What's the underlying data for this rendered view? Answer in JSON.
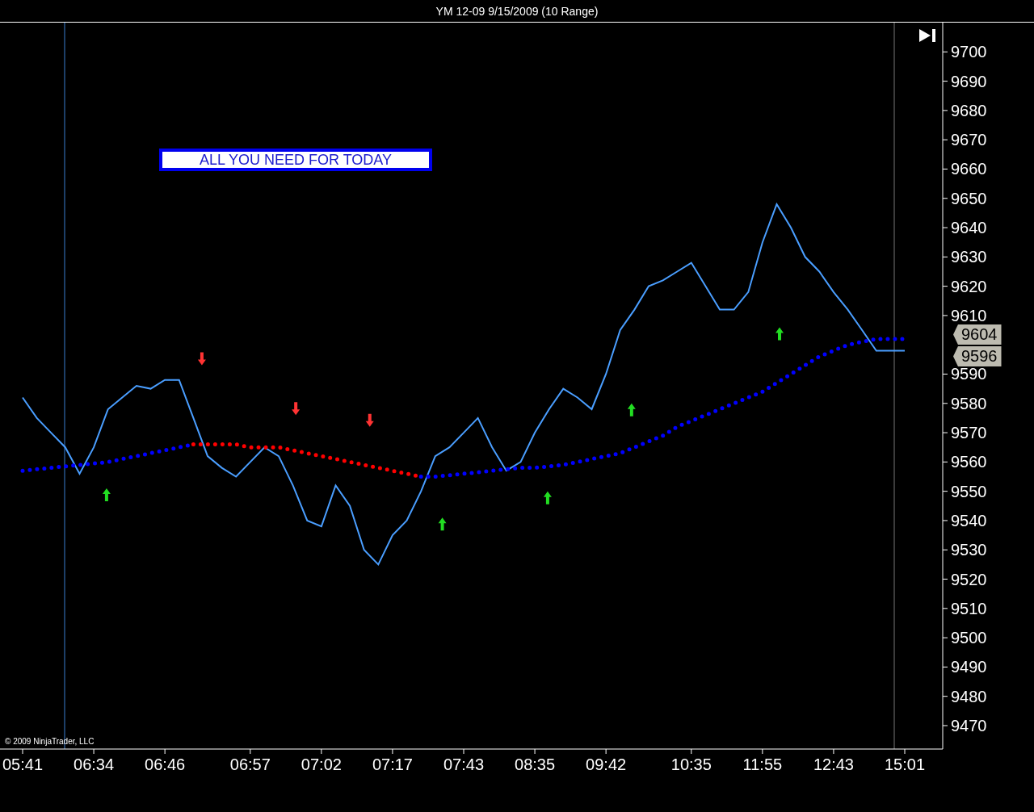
{
  "window": {
    "title": "YM 12-09  9/15/2009 (10 Range)"
  },
  "chart": {
    "banner": "ALL YOU NEED FOR TODAY",
    "copyright": "© 2009 NinjaTrader, LLC",
    "price_markers": [
      {
        "label": "9604"
      },
      {
        "label": "9596"
      }
    ],
    "chart_data": {
      "type": "line",
      "categories": [
        "05:41",
        null,
        null,
        null,
        null,
        "06:34",
        null,
        null,
        null,
        null,
        "06:46",
        null,
        null,
        null,
        null,
        null,
        "06:57",
        null,
        null,
        null,
        null,
        "07:02",
        null,
        null,
        null,
        null,
        "07:17",
        null,
        null,
        null,
        null,
        "07:43",
        null,
        null,
        null,
        null,
        "08:35",
        null,
        null,
        null,
        null,
        "09:42",
        null,
        null,
        null,
        null,
        null,
        "10:35",
        null,
        null,
        null,
        null,
        "11:55",
        null,
        null,
        null,
        null,
        "12:43",
        null,
        null,
        null,
        null,
        "15:01"
      ],
      "ylim": [
        9462,
        9710
      ],
      "yticks": [
        9470,
        9480,
        9490,
        9500,
        9510,
        9520,
        9530,
        9540,
        9550,
        9560,
        9570,
        9580,
        9590,
        9610,
        9620,
        9630,
        9640,
        9650,
        9660,
        9670,
        9680,
        9690,
        9700
      ],
      "series": [
        {
          "color": "#4a9eff",
          "values": [
            9582,
            9575,
            9570,
            9565,
            9556,
            9565,
            9578,
            9582,
            9586,
            9585,
            9588,
            9588,
            9575,
            9562,
            9558,
            9555,
            9560,
            9565,
            9562,
            9552,
            9540,
            9538,
            9552,
            9545,
            9530,
            9525,
            9535,
            9540,
            9550,
            9562,
            9565,
            9570,
            9575,
            9565,
            9557,
            9560,
            9570,
            9578,
            9585,
            9582,
            9578,
            9590,
            9605,
            9612,
            9620,
            9622,
            9625,
            9628,
            9620,
            9612,
            9612,
            9618,
            9635,
            9648,
            9640,
            9630,
            9625,
            9618,
            9612,
            9605,
            9598,
            9598,
            9598
          ]
        },
        {
          "color": "#0000ff",
          "line_style": "dotted",
          "values": [
            9557,
            9557.5,
            9558,
            9558.5,
            9559,
            9559.5,
            9560,
            9561,
            9562,
            9563,
            9564,
            9565,
            9566,
            null,
            null,
            null,
            null,
            null,
            null,
            null,
            null,
            null,
            null,
            null,
            null,
            null,
            null,
            null,
            9555,
            9555,
            9555.5,
            9556,
            9556.5,
            9557,
            9557.5,
            9558,
            9558,
            9558.5,
            9559,
            9560,
            9561,
            9562,
            9563,
            9565,
            9567,
            9569,
            9572,
            9574,
            9576,
            9578,
            9580,
            9582,
            9584,
            9587,
            9590,
            9593,
            9596,
            9598,
            9600,
            9601,
            9602,
            9602,
            9602
          ]
        },
        {
          "color": "#ff0000",
          "line_style": "dotted",
          "values": [
            null,
            null,
            null,
            null,
            null,
            null,
            null,
            null,
            null,
            null,
            null,
            null,
            9566,
            9566,
            9566,
            9566,
            9565,
            9565,
            9565,
            9564,
            9563,
            9562,
            9561,
            9560,
            9559,
            9558,
            9557,
            9556,
            9555,
            null,
            null,
            null,
            null,
            null,
            null,
            null,
            null,
            null,
            null,
            null,
            null,
            null,
            null,
            null,
            null,
            null,
            null,
            null,
            null,
            null,
            null,
            null,
            null,
            null,
            null,
            null,
            null,
            null,
            null,
            null,
            null,
            null,
            null
          ]
        }
      ]
    }
  }
}
